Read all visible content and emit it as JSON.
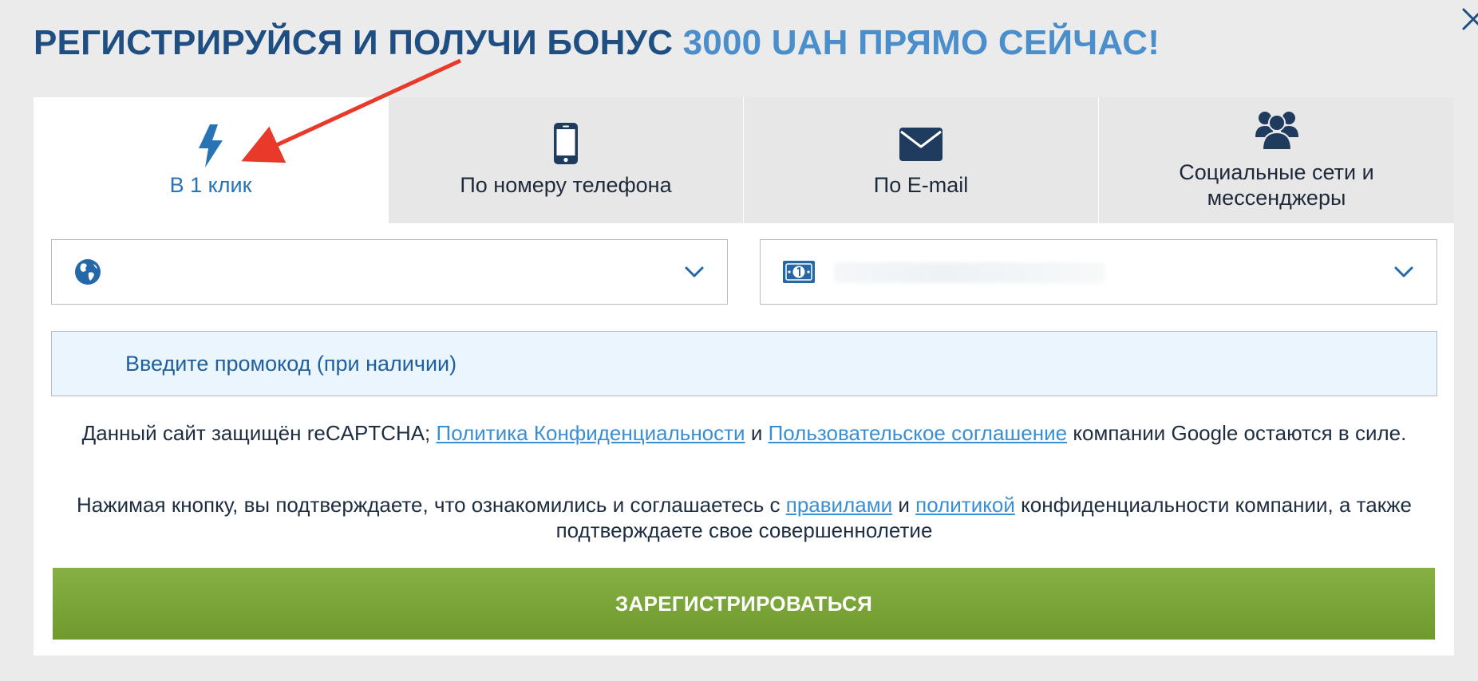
{
  "title": {
    "main": "РЕГИСТРИРУЙСЯ И ПОЛУЧИ БОНУС",
    "accent": "3000 UAH ПРЯМО СЕЙЧАС!"
  },
  "tabs": [
    {
      "label": "В 1 клик",
      "icon": "lightning-icon",
      "active": true
    },
    {
      "label": "По номеру телефона",
      "icon": "phone-icon",
      "active": false
    },
    {
      "label": "По E-mail",
      "icon": "envelope-icon",
      "active": false
    },
    {
      "label_line1": "Социальные сети и",
      "label_line2": "мессенджеры",
      "icon": "users-icon",
      "active": false
    }
  ],
  "country_select": {
    "icon": "globe-icon",
    "value": ""
  },
  "currency_select": {
    "icon": "banknote-icon",
    "value": ""
  },
  "promo": {
    "placeholder": "Введите промокод (при наличии)"
  },
  "recaptcha_notice": {
    "prefix": "Данный сайт защищён reCAPTCHA;",
    "privacy_link": "Политика Конфиденциальности",
    "and": "и",
    "terms_link": "Пользовательское соглашение",
    "suffix": "компании Google остаются в силе."
  },
  "consent_notice": {
    "prefix": "Нажимая кнопку, вы подтверждаете, что ознакомились и соглашаетесь с",
    "rules_link": "правилами",
    "and": "и",
    "policy_link": "политикой",
    "suffix": "конфиденциальности компании, а также подтверждаете свое совершеннолетие"
  },
  "register_button": {
    "label": "ЗАРЕГИСТРИРОВАТЬСЯ"
  },
  "colors": {
    "title": "#1f4f82",
    "title_accent": "#4a8fcb",
    "active_tab_text": "#2872b6",
    "link": "#3a8fd4",
    "button": "#7aa63a",
    "annotation_arrow": "#e8392b"
  }
}
